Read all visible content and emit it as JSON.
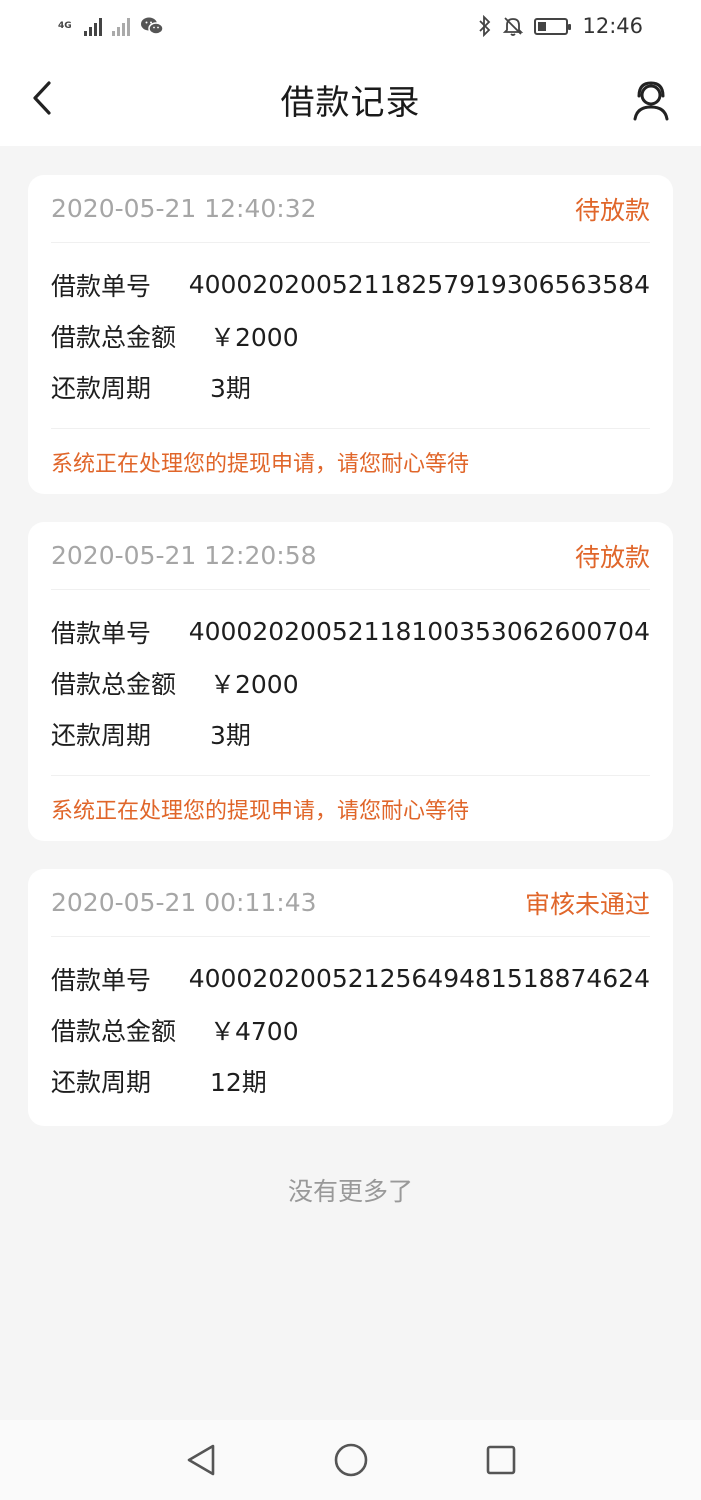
{
  "status_bar": {
    "network": "4G",
    "time": "12:46",
    "icons": [
      "signal-icon",
      "signal-off-icon",
      "wechat-icon",
      "bluetooth-icon",
      "mute-icon",
      "battery-icon"
    ]
  },
  "header": {
    "title": "借款记录",
    "back_icon": "chevron-left-icon",
    "service_icon": "customer-service-icon"
  },
  "records": [
    {
      "time": "2020-05-21 12:40:32",
      "status": "待放款",
      "fields": [
        {
          "label": "借款单号",
          "value": "40002020052118257919306563584"
        },
        {
          "label": "借款总金额",
          "value": "￥2000"
        },
        {
          "label": "还款周期",
          "value": "3期"
        }
      ],
      "note": "系统正在处理您的提现申请，请您耐心等待"
    },
    {
      "time": "2020-05-21 12:20:58",
      "status": "待放款",
      "fields": [
        {
          "label": "借款单号",
          "value": "40002020052118100353062600704"
        },
        {
          "label": "借款总金额",
          "value": "￥2000"
        },
        {
          "label": "还款周期",
          "value": "3期"
        }
      ],
      "note": "系统正在处理您的提现申请，请您耐心等待"
    },
    {
      "time": "2020-05-21 00:11:43",
      "status": "审核未通过",
      "fields": [
        {
          "label": "借款单号",
          "value": "40002020052125649481518874624"
        },
        {
          "label": "借款总金额",
          "value": "￥4700"
        },
        {
          "label": "还款周期",
          "value": "12期"
        }
      ],
      "note": ""
    }
  ],
  "footer": {
    "no_more": "没有更多了"
  },
  "colors": {
    "accent": "#e0662a",
    "background": "#f5f5f5",
    "muted": "#a6a6a6"
  }
}
